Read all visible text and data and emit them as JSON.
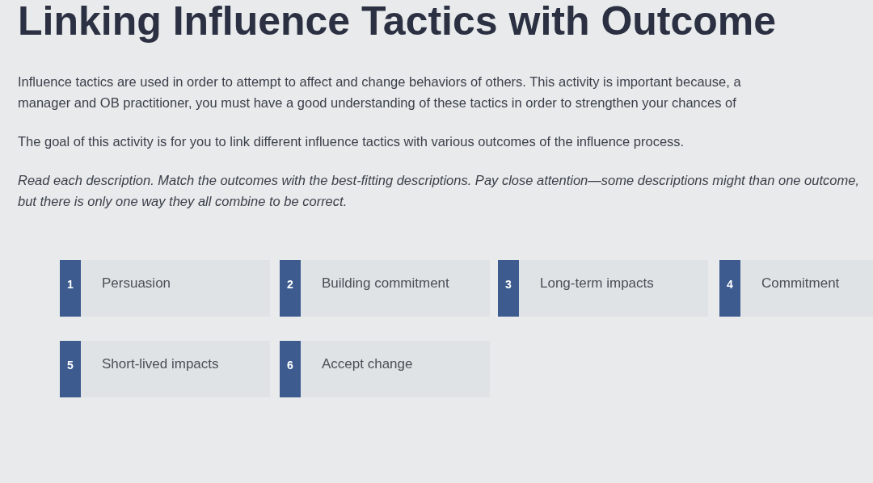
{
  "title": "Linking Influence Tactics with Outcome",
  "paragraphs": [
    {
      "kind": "plain",
      "text": "Influence tactics are used in order to attempt to affect and change behaviors of others. This activity is important because, a manager and OB practitioner, you must have a good understanding of these tactics in order to strengthen your chances of"
    },
    {
      "kind": "plain",
      "text": "The goal of this activity is for you to link different influence tactics with various outcomes of the influence process."
    },
    {
      "kind": "italic",
      "text": "Read each description. Match the outcomes with the best-fitting descriptions. Pay close attention—some descriptions might than one outcome, but there is only one way they all combine to be correct."
    }
  ],
  "cards": [
    {
      "number": "1",
      "label": "Persuasion"
    },
    {
      "number": "2",
      "label": "Building commitment"
    },
    {
      "number": "3",
      "label": "Long-term impacts"
    },
    {
      "number": "4",
      "label": "Commitment"
    },
    {
      "number": "5",
      "label": "Short-lived impacts"
    },
    {
      "number": "6",
      "label": "Accept change"
    }
  ]
}
